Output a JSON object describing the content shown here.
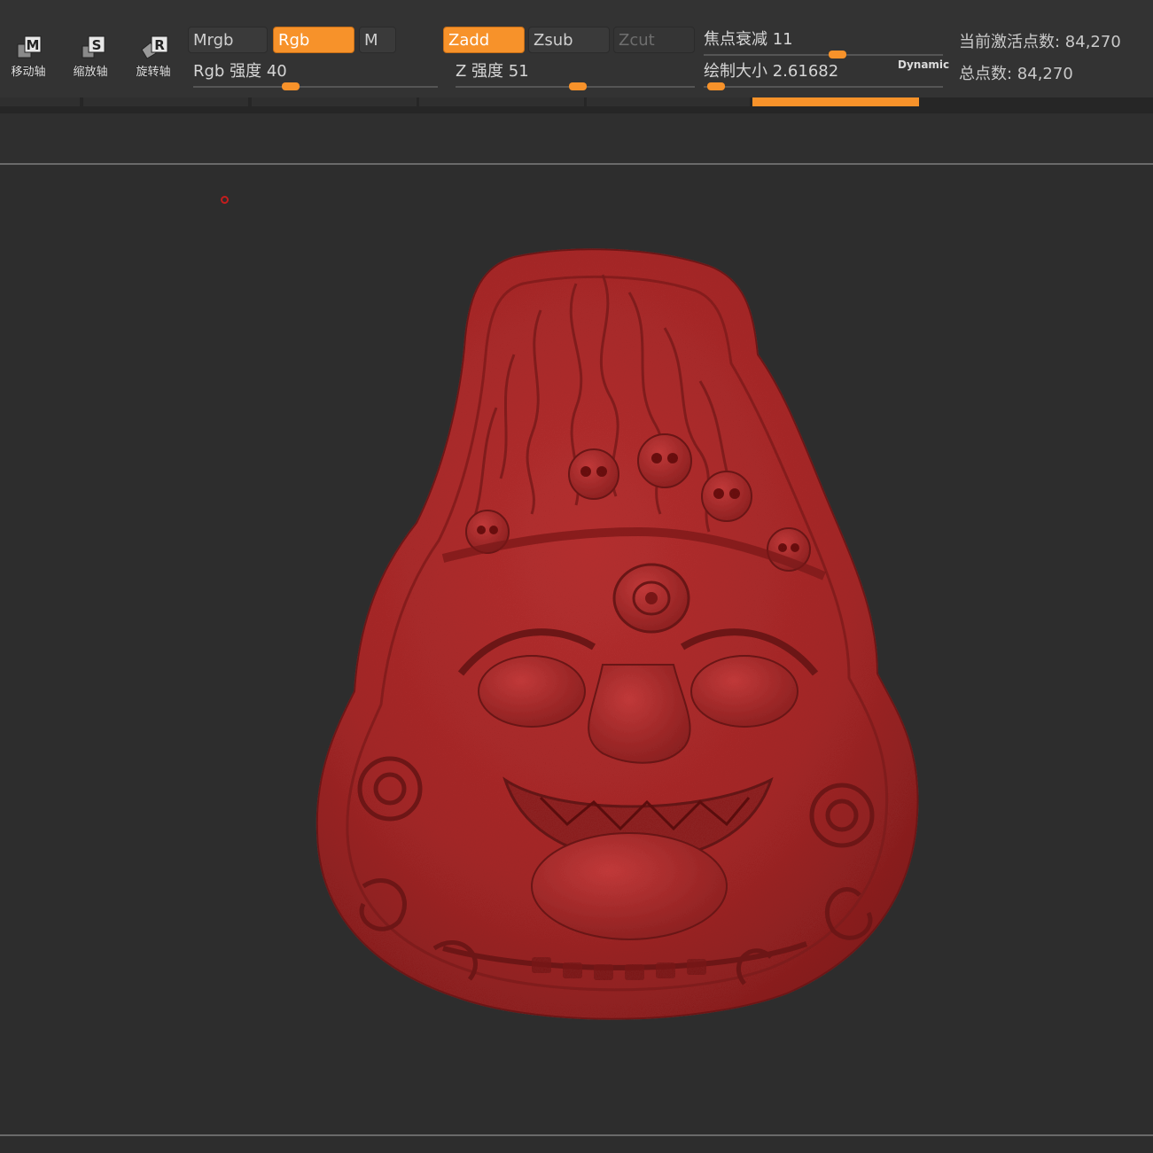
{
  "tools": {
    "move": {
      "label": "移动轴",
      "key": "M"
    },
    "scale": {
      "label": "缩放轴",
      "key": "S"
    },
    "rotate": {
      "label": "旋转轴",
      "key": "R"
    }
  },
  "color_modes": {
    "mrgb": "Mrgb",
    "rgb": "Rgb",
    "m": "M",
    "active": "Rgb"
  },
  "sculpt_modes": {
    "zadd": "Zadd",
    "zsub": "Zsub",
    "zcut": "Zcut",
    "active": "Zadd"
  },
  "sliders": {
    "rgb_intensity": {
      "label": "Rgb 强度",
      "value": "40",
      "fraction": 0.4
    },
    "z_intensity": {
      "label": "Z 强度",
      "value": "51",
      "fraction": 0.51
    },
    "focal_shift": {
      "label": "焦点衰减",
      "value": "11",
      "fraction": 0.56
    },
    "draw_size": {
      "label": "绘制大小",
      "value": "2.61682",
      "fraction": 0.05
    }
  },
  "dynamic_label": "Dynamic",
  "info": {
    "active_points_label": "当前激活点数",
    "active_points": "84,270",
    "total_points_label": "总点数",
    "total_points": "84,270"
  },
  "colors": {
    "accent": "#f7922a",
    "background": "#2d2d2d",
    "model": "#a82828"
  },
  "icons": [
    "move-axis-icon",
    "scale-axis-icon",
    "rotate-axis-icon",
    "brush-cursor-icon"
  ]
}
